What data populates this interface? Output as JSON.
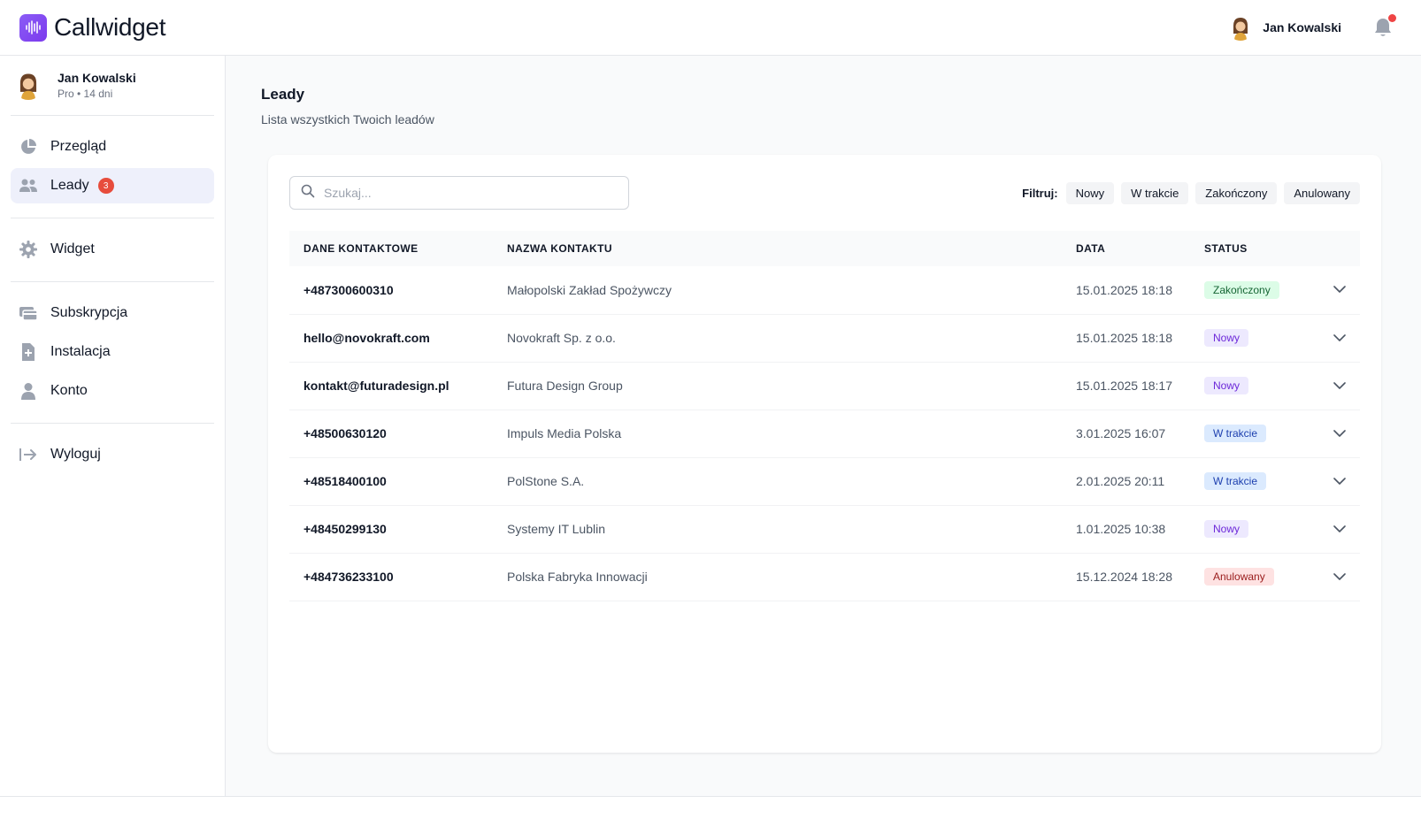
{
  "brand": {
    "name": "Callwidget",
    "logo_icon": "waveform-icon",
    "accent": "#7c3aed"
  },
  "header": {
    "user_name": "Jan Kowalski",
    "avatar": "avatar",
    "notification_icon": "bell-icon",
    "notification_dot_color": "#ef4444"
  },
  "sidebar": {
    "profile": {
      "name": "Jan Kowalski",
      "plan": "Pro • 14 dni"
    },
    "items": [
      {
        "label": "Przegląd",
        "icon": "pie-chart-icon"
      },
      {
        "label": "Leady",
        "icon": "users-icon",
        "badge": "3",
        "active": true
      },
      {
        "label": "Widget",
        "icon": "gear-icon"
      },
      {
        "label": "Subskrypcja",
        "icon": "credit-card-icon"
      },
      {
        "label": "Instalacja",
        "icon": "file-plus-icon"
      },
      {
        "label": "Konto",
        "icon": "user-icon"
      },
      {
        "label": "Wyloguj",
        "icon": "logout-icon"
      }
    ]
  },
  "page": {
    "title": "Leady",
    "subtitle": "Lista wszystkich Twoich leadów"
  },
  "search": {
    "placeholder": "Szukaj...",
    "value": ""
  },
  "filters": {
    "label": "Filtruj:",
    "options": [
      "Nowy",
      "W trakcie",
      "Zakończony",
      "Anulowany"
    ]
  },
  "table": {
    "columns": [
      "DANE KONTAKTOWE",
      "NAZWA KONTAKTU",
      "DATA",
      "STATUS"
    ],
    "rows": [
      {
        "contact": "+487300600310",
        "name": "Małopolski Zakład Spożywczy",
        "date": "15.01.2025 18:18",
        "status": "Zakończony"
      },
      {
        "contact": "hello@novokraft.com",
        "name": "Novokraft Sp. z o.o.",
        "date": "15.01.2025 18:18",
        "status": "Nowy"
      },
      {
        "contact": "kontakt@futuradesign.pl",
        "name": "Futura Design Group",
        "date": "15.01.2025 18:17",
        "status": "Nowy"
      },
      {
        "contact": "+48500630120",
        "name": "Impuls Media Polska",
        "date": "3.01.2025 16:07",
        "status": "W trakcie"
      },
      {
        "contact": "+48518400100",
        "name": "PolStone S.A.",
        "date": "2.01.2025 20:11",
        "status": "W trakcie"
      },
      {
        "contact": "+48450299130",
        "name": "Systemy IT Lublin",
        "date": "1.01.2025 10:38",
        "status": "Nowy"
      },
      {
        "contact": "+484736233100",
        "name": "Polska Fabryka Innowacji",
        "date": "15.12.2024 18:28",
        "status": "Anulowany"
      }
    ]
  },
  "status_colors": {
    "Zakończony": {
      "bg": "#dcfce7",
      "fg": "#166534"
    },
    "Nowy": {
      "bg": "#ede9fe",
      "fg": "#6d28d9"
    },
    "W trakcie": {
      "bg": "#dbeafe",
      "fg": "#1e40af"
    },
    "Anulowany": {
      "bg": "#fee2e2",
      "fg": "#991b1b"
    }
  }
}
